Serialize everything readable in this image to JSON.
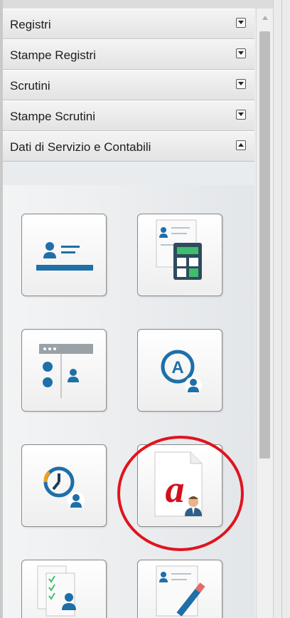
{
  "accordion": {
    "sections": [
      {
        "label": "Registri",
        "toggle_icon": "chevron-down-icon"
      },
      {
        "label": "Stampe Registri",
        "toggle_icon": "chevron-down-icon"
      },
      {
        "label": "Scrutini",
        "toggle_icon": "chevron-down-icon"
      },
      {
        "label": "Stampe Scrutini",
        "toggle_icon": "chevron-down-icon"
      },
      {
        "label": "Dati di Servizio e Contabili",
        "toggle_icon": "chevron-up-icon",
        "expanded": true
      }
    ]
  },
  "tiles": [
    {
      "icon": "id-card-icon"
    },
    {
      "icon": "calculator-document-icon"
    },
    {
      "icon": "window-user-list-icon"
    },
    {
      "icon": "user-letter-a-icon"
    },
    {
      "icon": "clock-user-icon"
    },
    {
      "icon": "acrobat-user-icon",
      "highlighted": true
    },
    {
      "icon": "checklist-user-icon"
    },
    {
      "icon": "document-edit-icon"
    }
  ],
  "colors": {
    "accent_blue": "#1f6fa8",
    "highlight_red": "#e0141e",
    "calculator_green": "#3ebf6b",
    "acrobat_red": "#d20f1c"
  }
}
